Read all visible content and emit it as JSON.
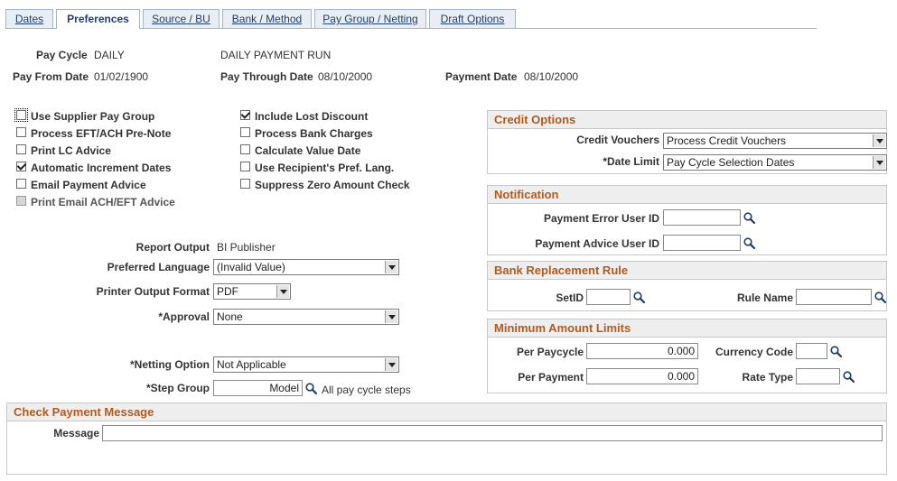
{
  "tabs": [
    {
      "label": "Dates"
    },
    {
      "label": "Preferences"
    },
    {
      "label": "Source / BU"
    },
    {
      "label": "Bank / Method"
    },
    {
      "label": "Pay Group / Netting"
    },
    {
      "label": "Draft Options"
    }
  ],
  "header": {
    "pay_cycle_label": "Pay Cycle",
    "pay_cycle_value": "DAILY",
    "pay_cycle_desc": "DAILY PAYMENT RUN",
    "pay_from_label": "Pay From Date",
    "pay_from_value": "01/02/1900",
    "pay_through_label": "Pay Through Date",
    "pay_through_value": "08/10/2000",
    "payment_date_label": "Payment Date",
    "payment_date_value": "08/10/2000"
  },
  "options_left": [
    {
      "label": "Use Supplier Pay Group",
      "checked": false
    },
    {
      "label": "Process EFT/ACH Pre-Note",
      "checked": false
    },
    {
      "label": "Print LC Advice",
      "checked": false
    },
    {
      "label": "Automatic Increment Dates",
      "checked": true
    },
    {
      "label": "Email Payment Advice",
      "checked": false
    },
    {
      "label": "Print Email ACH/EFT Advice",
      "checked": false
    }
  ],
  "options_right": [
    {
      "label": "Include Lost Discount",
      "checked": true
    },
    {
      "label": "Process Bank Charges",
      "checked": false
    },
    {
      "label": "Calculate Value Date",
      "checked": false
    },
    {
      "label": "Use Recipient's Pref. Lang.",
      "checked": false
    },
    {
      "label": "Suppress Zero Amount Check",
      "checked": false
    }
  ],
  "report": {
    "report_output_label": "Report Output",
    "report_output_value": "BI Publisher",
    "pref_lang_label": "Preferred Language",
    "pref_lang_value": "(Invalid Value)",
    "printer_format_label": "Printer Output Format",
    "printer_format_value": "PDF",
    "approval_label": "*Approval",
    "approval_value": "None",
    "netting_label": "*Netting Option",
    "netting_value": "Not Applicable",
    "step_group_label": "*Step Group",
    "step_group_value": "Model",
    "step_group_desc": "All pay cycle steps"
  },
  "credit_options": {
    "title": "Credit Options",
    "credit_vouchers_label": "Credit Vouchers",
    "credit_vouchers_value": "Process Credit Vouchers",
    "date_limit_label": "*Date Limit",
    "date_limit_value": "Pay Cycle Selection Dates"
  },
  "notification": {
    "title": "Notification",
    "error_user_label": "Payment Error User ID",
    "error_user_value": "",
    "advice_user_label": "Payment Advice User ID",
    "advice_user_value": ""
  },
  "bank_replacement": {
    "title": "Bank Replacement Rule",
    "setid_label": "SetID",
    "setid_value": "",
    "rule_name_label": "Rule Name",
    "rule_name_value": ""
  },
  "min_amount": {
    "title": "Minimum Amount Limits",
    "per_paycycle_label": "Per Paycycle",
    "per_paycycle_value": "0.000",
    "currency_code_label": "Currency Code",
    "currency_code_value": "",
    "per_payment_label": "Per Payment",
    "per_payment_value": "0.000",
    "rate_type_label": "Rate Type",
    "rate_type_value": ""
  },
  "check_message": {
    "title": "Check Payment Message",
    "message_label": "Message",
    "message_value": ""
  },
  "colors": {
    "group_title": "#b05a1f",
    "tab_text": "#1f3f6d"
  }
}
